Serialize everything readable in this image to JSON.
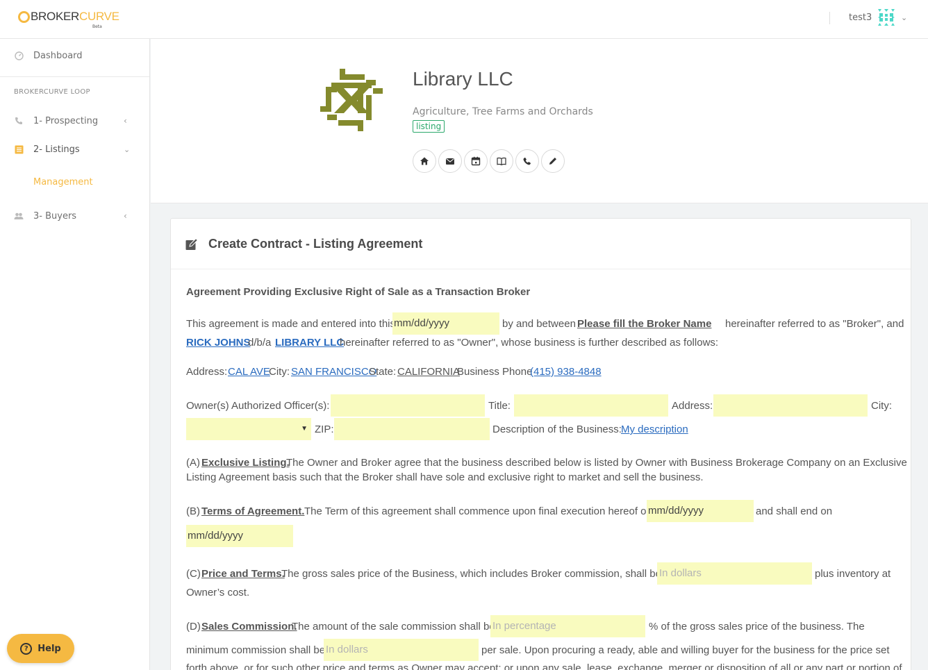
{
  "header": {
    "logo_part1": "BROKER",
    "logo_part2": "CURVE",
    "logo_beta": "Beta",
    "username": "test3"
  },
  "sidebar": {
    "dashboard": "Dashboard",
    "section": "BROKERCURVE LOOP",
    "items": [
      {
        "label": "1- Prospecting",
        "icon": "phone-icon"
      },
      {
        "label": "2- Listings",
        "icon": "list-icon"
      },
      {
        "label": "3- Buyers",
        "icon": "users-icon"
      }
    ],
    "sub_item": "Management",
    "help": "Help",
    "accent": "#f5b942"
  },
  "profile": {
    "name": "Library LLC",
    "industry": "Agriculture, Tree Farms and Orchards",
    "badge": "listing",
    "actions": [
      "home-icon",
      "envelope-icon",
      "calendar-icon",
      "book-icon",
      "phone-icon",
      "pencil-icon"
    ]
  },
  "card": {
    "title": "Create Contract - Listing Agreement",
    "heading": "Agreement Providing Exclusive Right of Sale as a Transaction Broker",
    "p1": {
      "t1": "This agreement is made and entered into this",
      "date_placeholder": "mm/dd/yyyy",
      "t2": "by and between",
      "broker": "Please fill the Broker Name",
      "t3": "hereinafter referred to as \"Broker\", and",
      "owner": "RICK JOHNS",
      "t4": "d/b/a",
      "company": "LIBRARY LLC",
      "t5": "hereinafter referred to as \"Owner\", whose business is further described as follows:"
    },
    "address": {
      "l_address": "Address:",
      "address": "CAL AVE",
      "l_city": "City:",
      "city": "SAN FRANCISCO",
      "l_state": "State:",
      "state": "CALIFORNIA",
      "l_phone": "Business Phone",
      "phone": "(415) 938-4848"
    },
    "owner_row": {
      "l_officers": "Owner(s) Authorized Officer(s):",
      "l_title": "Title:",
      "l_address": "Address:",
      "l_city": "City:",
      "l_zip": "ZIP:",
      "l_desc": "Description of the Business:",
      "desc": "My description"
    },
    "a": {
      "prefix": "(A)",
      "title": "Exclusive Listing.",
      "line1": "The Owner and Broker agree that the business described below is listed by Owner with Business Brokerage Company on an Exclusive",
      "line2": "Listing Agreement basis such that the Broker shall have sole and exclusive right to market and sell the business."
    },
    "b": {
      "prefix": "(B)",
      "title": "Terms of Agreement.",
      "t1": "The Term of this agreement shall commence upon final execution hereof or",
      "start_placeholder": "mm/dd/yyyy",
      "t2": "and shall end on",
      "end_placeholder": "mm/dd/yyyy"
    },
    "c": {
      "prefix": "(C)",
      "title": "Price and Terms.",
      "t1": "The gross sales price of the Business, which includes Broker commission, shall be: $",
      "price_placeholder": "In dollars",
      "t2": "plus inventory at",
      "t3": "Owner’s cost."
    },
    "d": {
      "prefix": "(D)",
      "title": "Sales Commission.",
      "t1": "The amount of the sale commission shall be",
      "pct_placeholder": "In percentage",
      "t2": "% of the gross sales price of the business. The",
      "t3": "minimum commission shall be",
      "min_placeholder": "In dollars",
      "t4": "per sale. Upon procuring a ready, able and willing buyer for the business for the price set",
      "t5": "forth above, or for such other price and terms as Owner may accept; or upon any sale, lease, exchange, merger or disposition of all or any part or portion of"
    }
  }
}
